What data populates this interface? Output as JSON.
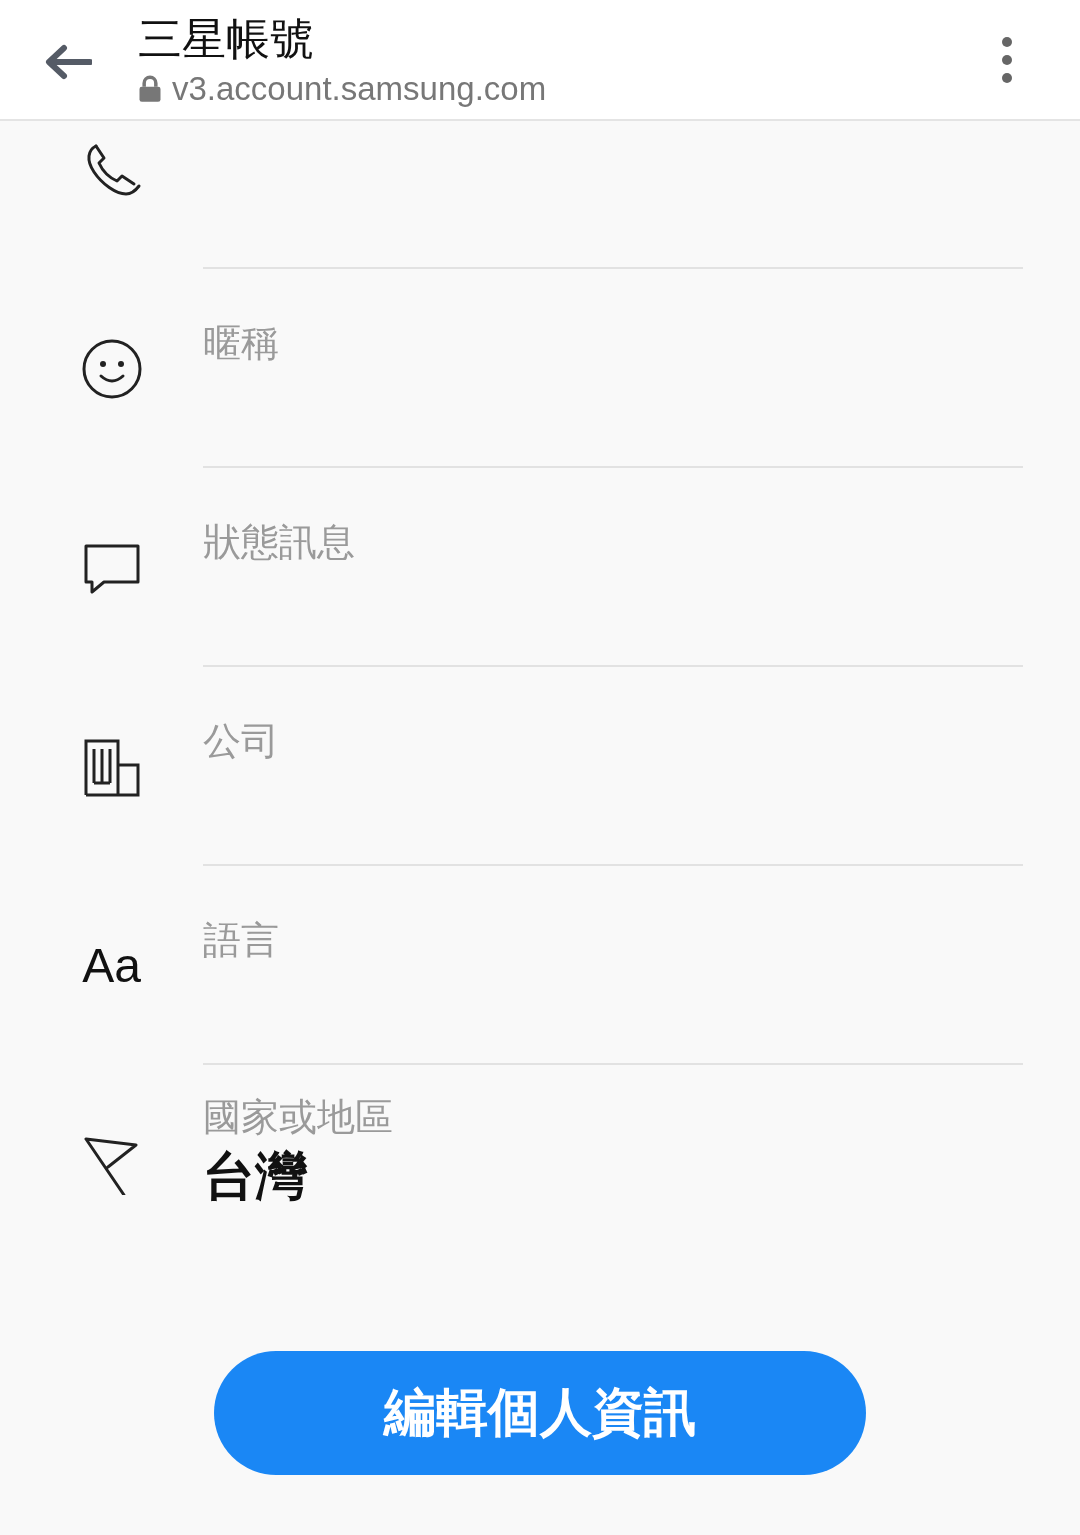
{
  "header": {
    "title": "三星帳號",
    "url": "v3.account.samsung.com"
  },
  "fields": [
    {
      "label": "暱稱"
    },
    {
      "label": "狀態訊息"
    },
    {
      "label": "公司"
    },
    {
      "label": "語言",
      "icon_text": "Aa"
    },
    {
      "label": "國家或地區",
      "value": "台灣"
    }
  ],
  "button": "編輯個人資訊"
}
